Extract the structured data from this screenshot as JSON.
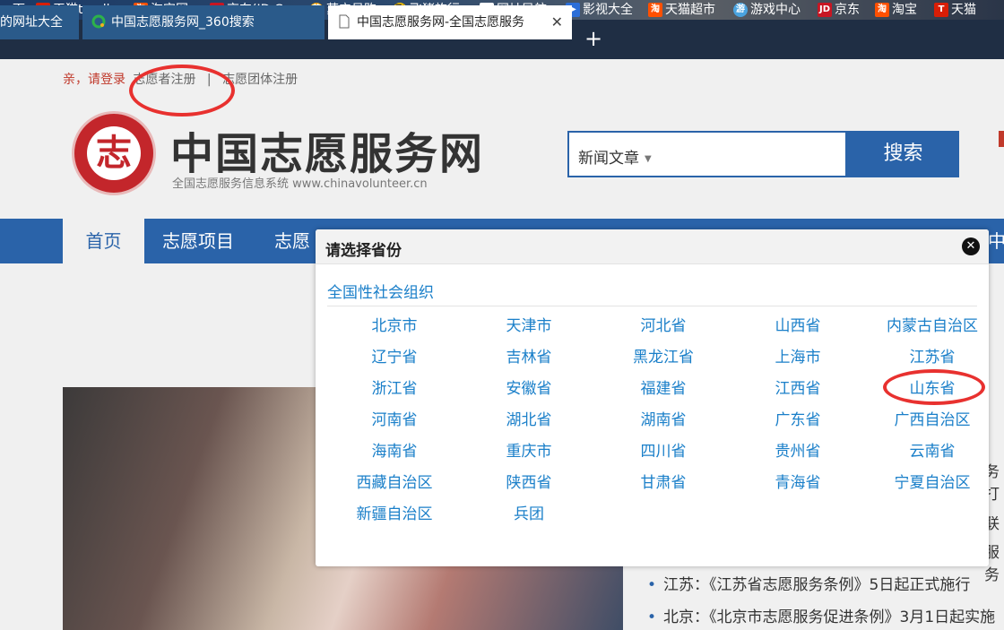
{
  "bookmarks": [
    {
      "label": "一下",
      "icon": "none"
    },
    {
      "label": "天猫tmall.",
      "icon": "T"
    },
    {
      "label": "淘宝网",
      "icon": "淘"
    },
    {
      "label": "京东(JD.C",
      "icon": "JD"
    },
    {
      "label": "苏宁易购",
      "icon": "苏"
    },
    {
      "label": "飞猪旅行",
      "icon": "飞"
    },
    {
      "label": "网址导航",
      "icon": "doc"
    },
    {
      "label": "影视大全",
      "icon": "▶"
    },
    {
      "label": "天猫超市",
      "icon": "淘"
    },
    {
      "label": "游戏中心",
      "icon": "游"
    },
    {
      "label": "京东",
      "icon": "JD"
    },
    {
      "label": "淘宝",
      "icon": "淘"
    },
    {
      "label": "天猫",
      "icon": "T"
    }
  ],
  "tabs": [
    {
      "label": "的网址大全"
    },
    {
      "label": "中国志愿服务网_360搜索"
    },
    {
      "label": "中国志愿服务网-全国志愿服务"
    }
  ],
  "top_links": {
    "greeting": "亲，请登录",
    "volunteer_register": "志愿者注册",
    "divider": "|",
    "group_register": "志愿团体注册"
  },
  "site": {
    "title": "中国志愿服务网",
    "subtitle": "全国志愿服务信息系统 www.chinavolunteer.cn",
    "logo_char": "志"
  },
  "search": {
    "type": "新闻文章",
    "button": "搜索"
  },
  "nav": {
    "home": "首页",
    "projects": "志愿项目",
    "partial": "志愿",
    "right_partial": "中"
  },
  "news": [
    {
      "text": "江苏：《江苏省志愿服务条例》5日起正式施行"
    },
    {
      "text": "北京：《北京市志愿服务促进条例》3月1日起实施"
    }
  ],
  "news_edge": [
    "务打",
    "联",
    "服务"
  ],
  "modal": {
    "title": "请选择省份",
    "close": "✕",
    "national": "全国性社会组织",
    "provinces": [
      "北京市",
      "天津市",
      "河北省",
      "山西省",
      "内蒙古自治区",
      "辽宁省",
      "吉林省",
      "黑龙江省",
      "上海市",
      "江苏省",
      "浙江省",
      "安徽省",
      "福建省",
      "江西省",
      "山东省",
      "河南省",
      "湖北省",
      "湖南省",
      "广东省",
      "广西自治区",
      "海南省",
      "重庆市",
      "四川省",
      "贵州省",
      "云南省",
      "西藏自治区",
      "陕西省",
      "甘肃省",
      "青海省",
      "宁夏自治区",
      "新疆自治区",
      "兵团"
    ]
  },
  "colors": {
    "accent": "#2a63a9",
    "link": "#1a7fc9",
    "annotation": "#e8312f"
  }
}
